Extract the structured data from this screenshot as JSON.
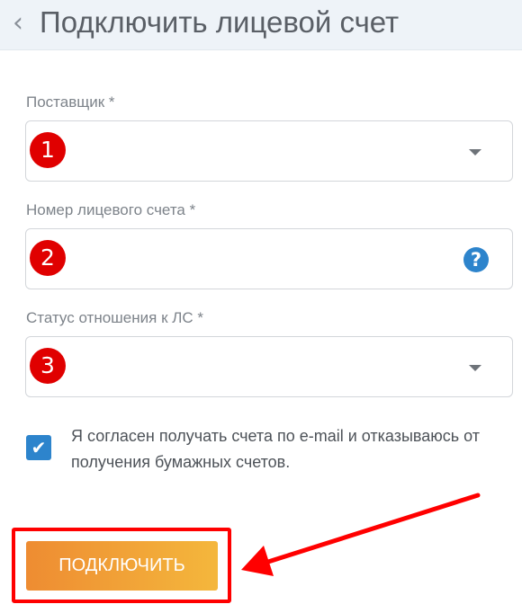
{
  "header": {
    "back_icon": "chevron-left-icon",
    "title": "Подключить лицевой счет"
  },
  "form": {
    "supplier": {
      "label": "Поставщик *",
      "value": "",
      "badge": "1"
    },
    "account_number": {
      "label": "Номер лицевого счета *",
      "value": "",
      "badge": "2",
      "help_icon": "question-icon"
    },
    "status": {
      "label": "Статус отношения к ЛС *",
      "value": "",
      "badge": "3"
    },
    "consent": {
      "checked": true,
      "text": "Я согласен получать счета по e-mail и отказываюсь от получения бумажных счетов."
    }
  },
  "actions": {
    "connect_label": "ПОДКЛЮЧИТЬ"
  },
  "colors": {
    "accent": "#2d84cc",
    "button_start": "#ee8c32",
    "button_end": "#f4b73c",
    "annotation": "#ff0000"
  }
}
